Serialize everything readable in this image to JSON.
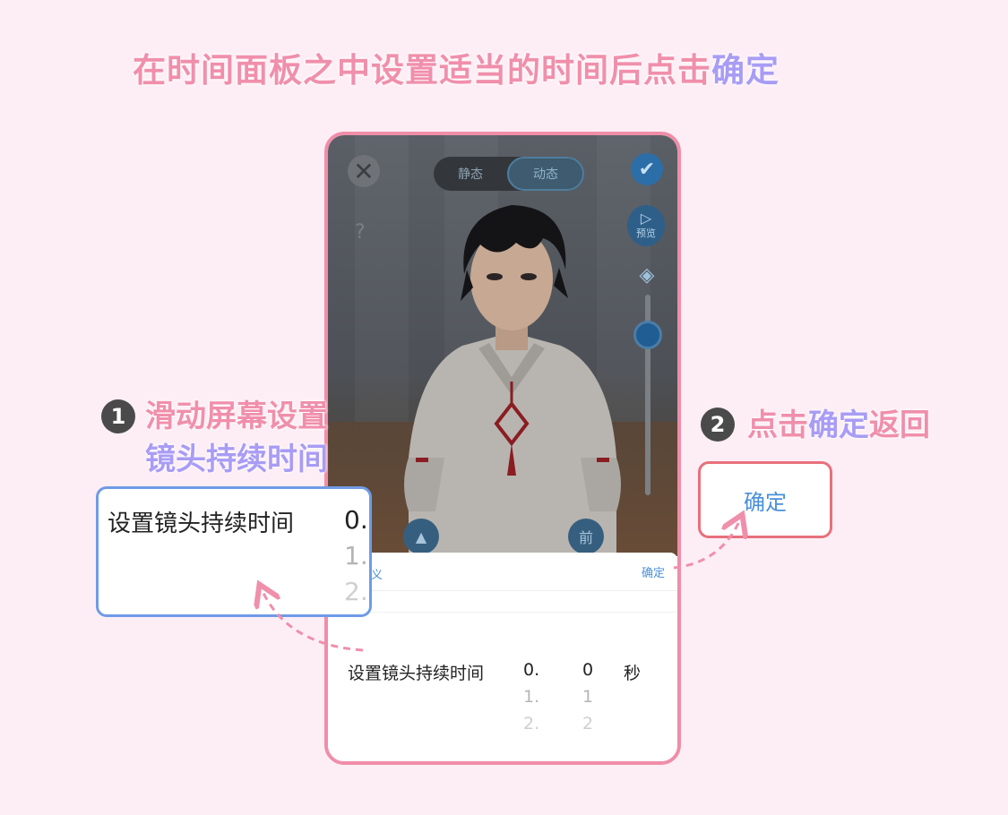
{
  "header": {
    "instruction_main": "在时间面板之中设置适当的时间后点击",
    "instruction_accent": "确定"
  },
  "phone": {
    "segment_static": "静态",
    "segment_dynamic": "动态",
    "preview_label": "预览",
    "help_symbol": "?",
    "nav_front_label": "前",
    "slider_value": 0.15,
    "sheet": {
      "cancel_label": "义",
      "confirm_label": "确定",
      "picker_label": "设置镜头持续时间",
      "col1": [
        "0.",
        "1.",
        "2."
      ],
      "col2": [
        "0",
        "1",
        "2"
      ],
      "unit": "秒"
    }
  },
  "step1": {
    "number": "1",
    "line1": "滑动屏幕设置",
    "line2": "镜头持续时间",
    "zoom_label": "设置镜头持续时间",
    "zoom_values": [
      "0.",
      "1.",
      "2."
    ]
  },
  "step2": {
    "number": "2",
    "text_a": "点击",
    "text_b": "确定",
    "text_c": "返回",
    "button_label": "确定"
  },
  "colors": {
    "background": "#fdeef5",
    "pink": "#f08fab",
    "purple": "#a89cf5",
    "blue_link": "#4a90d9",
    "zoom_border": "#6f9be6",
    "ok_border": "#e7707c",
    "phone_border": "#f08da8"
  }
}
